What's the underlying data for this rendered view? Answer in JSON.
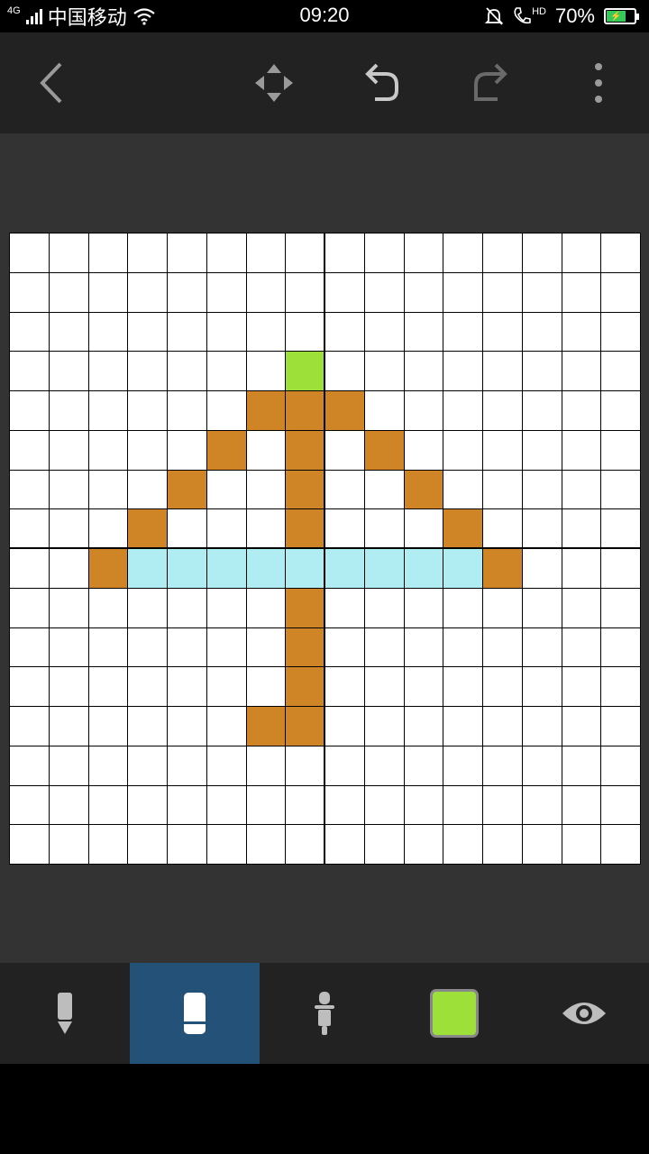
{
  "status_bar": {
    "network": "4G",
    "carrier": "中国移动",
    "time": "09:20",
    "hd_label": "HD",
    "battery": "70%",
    "battery_level": 0.7
  },
  "toolbar": {
    "icons": [
      "back-icon",
      "move-icon",
      "undo-icon",
      "redo-icon",
      "more-icon"
    ]
  },
  "grid": {
    "cols": 16,
    "rows": 16,
    "cells": [
      {
        "row": 3,
        "col": 7,
        "color": "#9ee03a"
      },
      {
        "row": 4,
        "col": 6,
        "color": "#cf8526"
      },
      {
        "row": 4,
        "col": 7,
        "color": "#cf8526"
      },
      {
        "row": 4,
        "col": 8,
        "color": "#cf8526"
      },
      {
        "row": 5,
        "col": 5,
        "color": "#cf8526"
      },
      {
        "row": 5,
        "col": 7,
        "color": "#cf8526"
      },
      {
        "row": 5,
        "col": 9,
        "color": "#cf8526"
      },
      {
        "row": 6,
        "col": 4,
        "color": "#cf8526"
      },
      {
        "row": 6,
        "col": 7,
        "color": "#cf8526"
      },
      {
        "row": 6,
        "col": 10,
        "color": "#cf8526"
      },
      {
        "row": 7,
        "col": 3,
        "color": "#cf8526"
      },
      {
        "row": 7,
        "col": 7,
        "color": "#cf8526"
      },
      {
        "row": 7,
        "col": 11,
        "color": "#cf8526"
      },
      {
        "row": 8,
        "col": 2,
        "color": "#cf8526"
      },
      {
        "row": 8,
        "col": 3,
        "color": "#b0edf3"
      },
      {
        "row": 8,
        "col": 4,
        "color": "#b0edf3"
      },
      {
        "row": 8,
        "col": 5,
        "color": "#b0edf3"
      },
      {
        "row": 8,
        "col": 6,
        "color": "#b0edf3"
      },
      {
        "row": 8,
        "col": 7,
        "color": "#b0edf3"
      },
      {
        "row": 8,
        "col": 8,
        "color": "#b0edf3"
      },
      {
        "row": 8,
        "col": 9,
        "color": "#b0edf3"
      },
      {
        "row": 8,
        "col": 10,
        "color": "#b0edf3"
      },
      {
        "row": 8,
        "col": 11,
        "color": "#b0edf3"
      },
      {
        "row": 8,
        "col": 12,
        "color": "#cf8526"
      },
      {
        "row": 9,
        "col": 7,
        "color": "#cf8526"
      },
      {
        "row": 10,
        "col": 7,
        "color": "#cf8526"
      },
      {
        "row": 11,
        "col": 7,
        "color": "#cf8526"
      },
      {
        "row": 12,
        "col": 6,
        "color": "#cf8526"
      },
      {
        "row": 12,
        "col": 7,
        "color": "#cf8526"
      }
    ]
  },
  "bottom_tools": {
    "items": [
      "pencil-icon",
      "eraser-icon",
      "eyedropper-icon",
      "color-swatch",
      "eye-icon"
    ],
    "active": "eraser-icon",
    "current_color": "#9ee03a"
  },
  "colors": {
    "toolbar_bg": "#222222",
    "canvas_bg": "#333333",
    "active_tool_bg": "#245177",
    "orange": "#cf8526",
    "cyan": "#b0edf3",
    "green": "#9ee03a"
  }
}
